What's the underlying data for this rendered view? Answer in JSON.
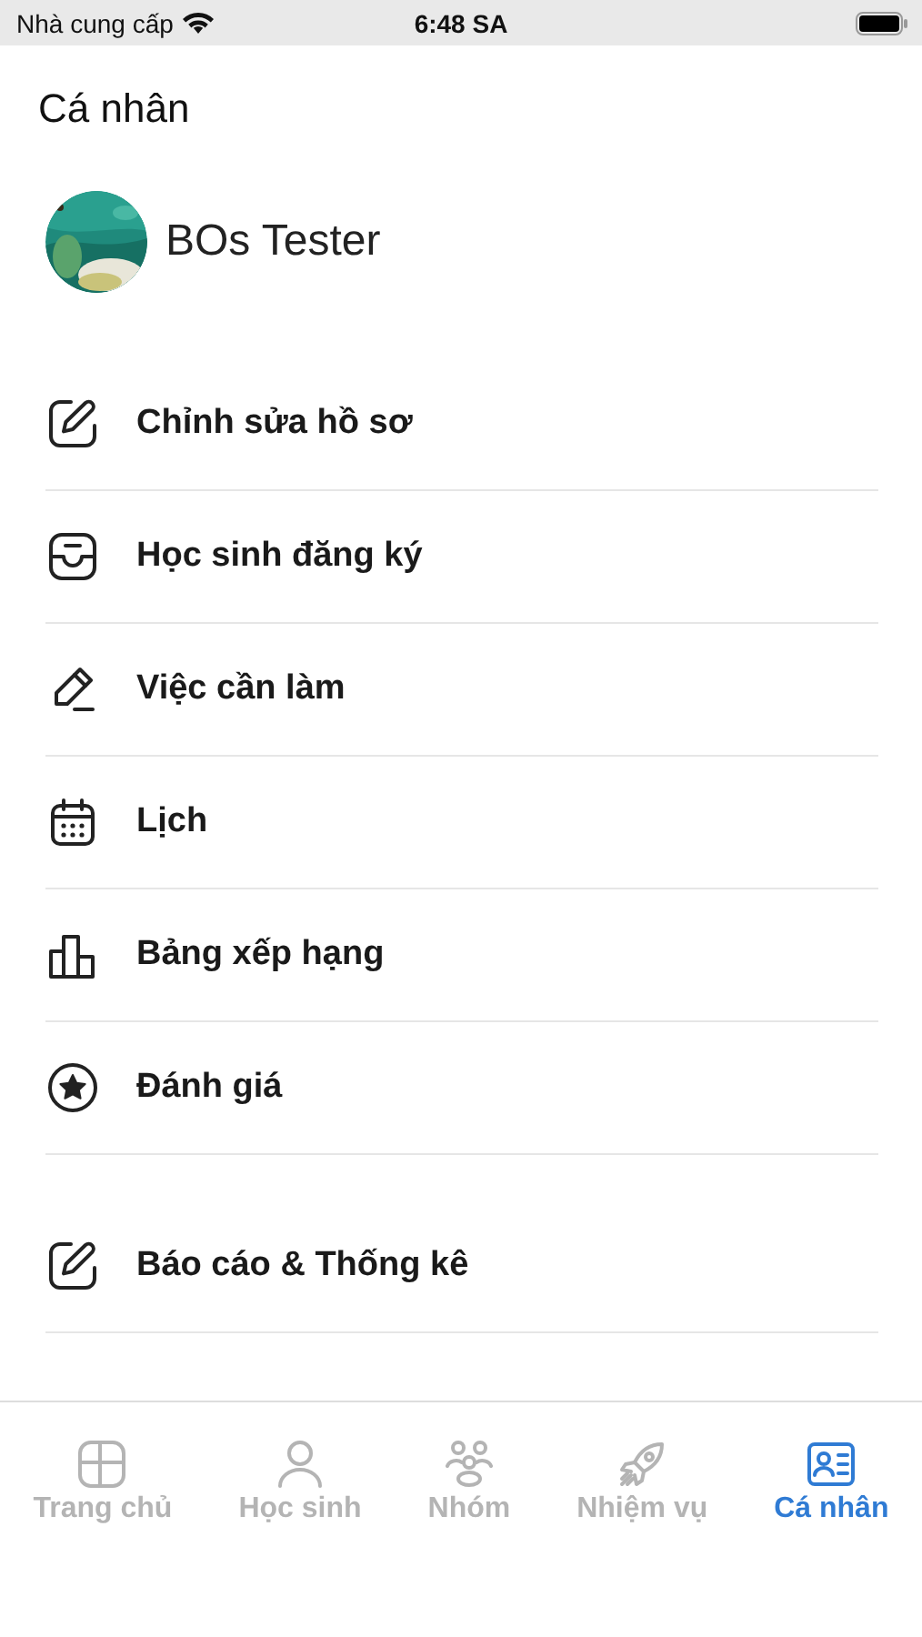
{
  "status_bar": {
    "carrier": "Nhà cung cấp",
    "time": "6:48 SA"
  },
  "title": "Cá nhân",
  "profile": {
    "name": "BOs Tester"
  },
  "sections": [
    {
      "items": [
        {
          "label": "Chỉnh sửa hồ sơ"
        },
        {
          "label": "Học sinh đăng ký"
        },
        {
          "label": "Việc cần làm"
        },
        {
          "label": "Lịch"
        },
        {
          "label": "Bảng xếp hạng"
        },
        {
          "label": "Đánh giá"
        }
      ]
    },
    {
      "items": [
        {
          "label": "Báo cáo & Thống kê"
        }
      ]
    }
  ],
  "tab_bar": [
    {
      "label": "Trang chủ",
      "selected": false
    },
    {
      "label": "Học sinh",
      "selected": false
    },
    {
      "label": "Nhóm",
      "selected": false
    },
    {
      "label": "Nhiệm vụ",
      "selected": false
    },
    {
      "label": "Cá nhân",
      "selected": true
    }
  ]
}
